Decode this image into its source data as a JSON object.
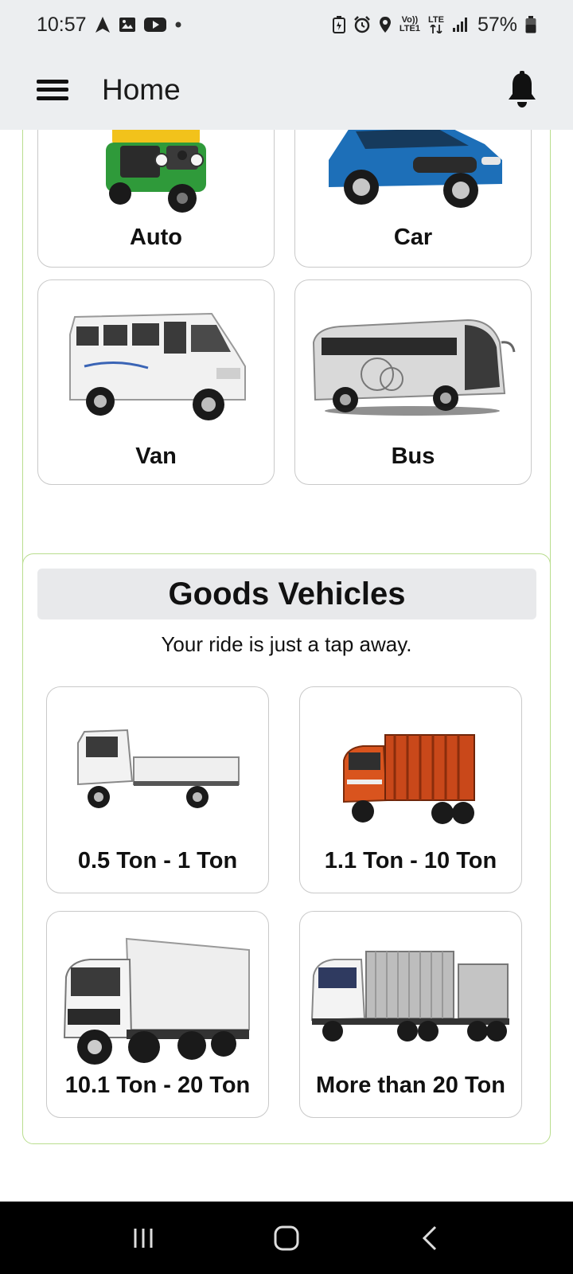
{
  "status_bar": {
    "time": "10:57",
    "volte_label": "Vo))",
    "lte1_label": "LTE1",
    "lte_label": "LTE",
    "battery": "57%",
    "icons": [
      "navigation-icon",
      "gallery-icon",
      "youtube-icon",
      "dot-icon",
      "battery-saver-icon",
      "alarm-icon",
      "location-icon",
      "signal-icon",
      "battery-icon"
    ]
  },
  "app_bar": {
    "title": "Home",
    "menu_icon": "hamburger-menu-icon",
    "bell_icon": "bell-icon"
  },
  "passenger": {
    "vehicles": [
      {
        "label": "Auto",
        "icon": "auto-rickshaw-icon"
      },
      {
        "label": "Car",
        "icon": "car-icon"
      },
      {
        "label": "Van",
        "icon": "van-icon"
      },
      {
        "label": "Bus",
        "icon": "bus-icon"
      }
    ]
  },
  "goods": {
    "title": "Goods Vehicles",
    "subtitle": "Your ride is just a tap away.",
    "vehicles": [
      {
        "label": "0.5 Ton - 1 Ton",
        "icon": "mini-truck-icon"
      },
      {
        "label": "1.1 Ton - 10 Ton",
        "icon": "cargo-truck-icon"
      },
      {
        "label": "10.1 Ton - 20 Ton",
        "icon": "dump-truck-icon"
      },
      {
        "label": "More than 20 Ton",
        "icon": "trailer-truck-icon"
      }
    ]
  },
  "nav_bar": {
    "icons": [
      "recent-apps-icon",
      "home-icon",
      "back-icon"
    ]
  },
  "colors": {
    "bar_background": "#eceef0",
    "section_border": "#b9dd8e",
    "card_border": "#c9c9c9",
    "heading_background": "#e8e9eb",
    "auto_green": "#2f9a3a",
    "auto_yellow": "#f2c21b",
    "car_blue": "#1d6fb8",
    "truck_orange": "#d9541e"
  }
}
